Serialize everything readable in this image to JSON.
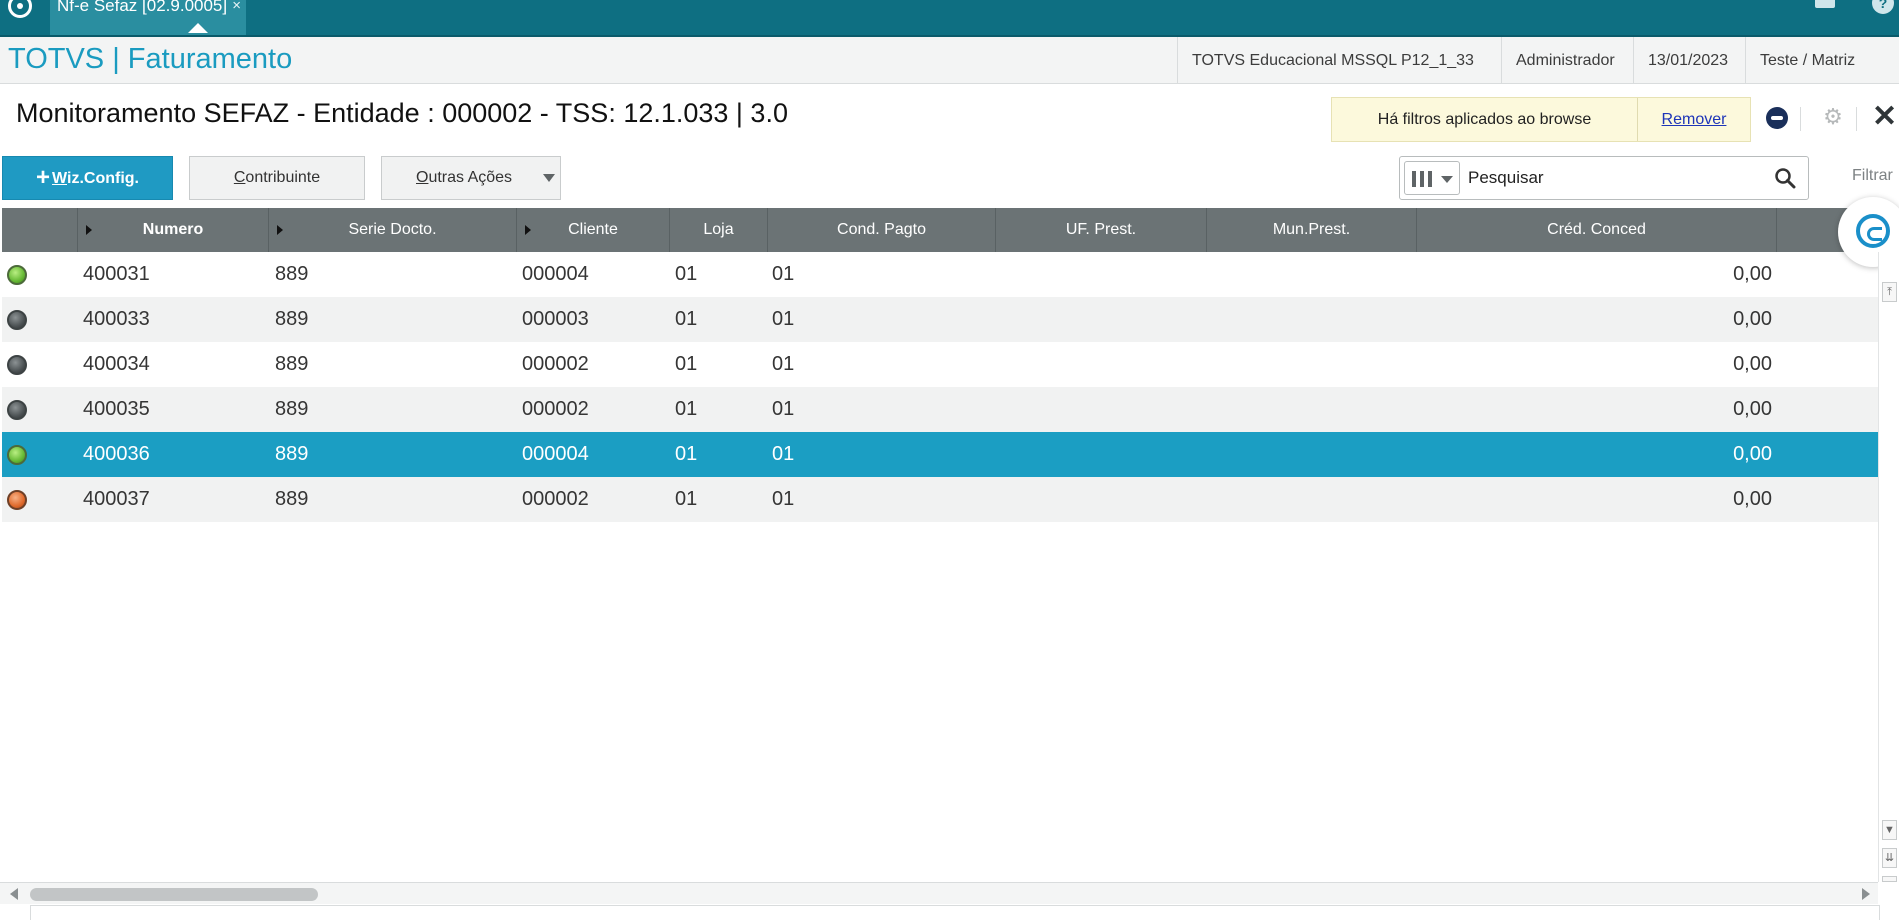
{
  "tab": {
    "label": "Nf-e Sefaz [02.9.0005]",
    "close": "×"
  },
  "header": {
    "app_title": "TOTVS | Faturamento",
    "environment": "TOTVS Educacional MSSQL P12_1_33",
    "user": "Administrador",
    "date": "13/01/2023",
    "company": "Teste / Matriz"
  },
  "page": {
    "title": "Monitoramento SEFAZ - Entidade : 000002 - TSS: 12.1.033 | 3.0",
    "filter_notice": "Há filtros aplicados ao browse",
    "filter_remove": "Remover"
  },
  "toolbar": {
    "wiz_prefix": "W",
    "wiz_rest": "iz.Config.",
    "contrib_prefix": "C",
    "contrib_rest": "ontribuinte",
    "outras_prefix": "O",
    "outras_rest": "utras Ações"
  },
  "search": {
    "placeholder": "Pesquisar",
    "filter_label": "Filtrar"
  },
  "grid": {
    "columns": [
      "Numero",
      "Serie Docto.",
      "Cliente",
      "Loja",
      "Cond. Pagto",
      "UF. Prest.",
      "Mun.Prest.",
      "Créd. Conced"
    ],
    "rows": [
      {
        "status": "green",
        "numero": "400031",
        "serie": "889",
        "cliente": "000004",
        "loja": "01",
        "cond": "01",
        "cred": "0,00"
      },
      {
        "status": "gray",
        "numero": "400033",
        "serie": "889",
        "cliente": "000003",
        "loja": "01",
        "cond": "01",
        "cred": "0,00"
      },
      {
        "status": "gray",
        "numero": "400034",
        "serie": "889",
        "cliente": "000002",
        "loja": "01",
        "cond": "01",
        "cred": "0,00"
      },
      {
        "status": "gray",
        "numero": "400035",
        "serie": "889",
        "cliente": "000002",
        "loja": "01",
        "cond": "01",
        "cred": "0,00"
      },
      {
        "status": "green",
        "numero": "400036",
        "serie": "889",
        "cliente": "000004",
        "loja": "01",
        "cond": "01",
        "cred": "0,00"
      },
      {
        "status": "orange",
        "numero": "400037",
        "serie": "889",
        "cliente": "000002",
        "loja": "01",
        "cond": "01",
        "cred": "0,00"
      }
    ],
    "selected_row": 4
  },
  "colors": {
    "topbar": "#0e6f82",
    "accent": "#1a9bc0",
    "selected_row": "#1b9ec3",
    "grid_header": "#6b7375",
    "notice_bg": "#fcf9dc"
  },
  "icons": {
    "app_logo": "totvs-logo-icon",
    "mail": "mail-icon",
    "help": "help-icon",
    "chat": "chat-icon",
    "settings": "gear-icon",
    "close": "close-icon",
    "columns": "columns-icon",
    "search": "search-icon",
    "assistant": "assistant-bubble-icon"
  }
}
